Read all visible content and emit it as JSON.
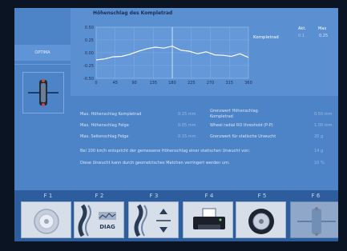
{
  "left_menu": {
    "items": [
      "",
      "",
      "OPTIMA"
    ]
  },
  "chart": {
    "title": "Höhenschlag des Kompletrad",
    "legend": {
      "akt_header": "Akt.",
      "max_header": "Max",
      "series_label": "Kompletrad",
      "akt_value": "0.1",
      "max_value": "0.25"
    }
  },
  "chart_data": {
    "type": "line",
    "title": "Höhenschlag des Kompletrad",
    "xlabel": "",
    "ylabel": "",
    "xlim": [
      0,
      360
    ],
    "ylim": [
      -0.5,
      0.5
    ],
    "x_ticks": [
      "0",
      "45",
      "90",
      "135",
      "180",
      "225",
      "270",
      "315",
      "360"
    ],
    "y_ticks": [
      "0.50",
      "0.25",
      "0.00",
      "-0.25",
      "-0.50"
    ],
    "grid": true,
    "cursor_x": 180,
    "series": [
      {
        "name": "Kompletrad",
        "color": "#ffffff",
        "x": [
          0,
          20,
          40,
          60,
          80,
          100,
          120,
          140,
          160,
          180,
          200,
          220,
          240,
          260,
          280,
          300,
          320,
          340,
          360
        ],
        "values": [
          -0.14,
          -0.12,
          -0.08,
          -0.07,
          -0.03,
          0.03,
          0.08,
          0.11,
          0.09,
          0.13,
          0.05,
          0.03,
          -0.02,
          0.02,
          -0.04,
          -0.05,
          -0.07,
          -0.02,
          -0.09
        ]
      }
    ]
  },
  "results": {
    "rows": [
      {
        "label": "Max. Höhenschlag Kompletrad",
        "value": "0.25 mm",
        "label2": "Grenzwert Höhenschlag Kompletrad",
        "value2": "0.50 mm"
      },
      {
        "label": "Max. Höhenschlag Felge",
        "value": "0.05 mm",
        "label2": "Wheel radial RO threshold (P-P)",
        "value2": "1.00 mm"
      },
      {
        "label": "Max. Seitenschlag Felge",
        "value": "0.15 mm",
        "label2": "Grenzwert für statische Unwucht",
        "value2": "20 g"
      }
    ],
    "line1": "Bei 100 km/h entspricht der gemessene Höhenschlag einer statischen Unwucht von:",
    "line1_value": "14 g",
    "line2": "Diese Unwucht kann durch geometrisches Matchen verringert werden um:",
    "line2_value": "10 %"
  },
  "fkeys": [
    {
      "label": "F 1",
      "icon": "wheel-icon"
    },
    {
      "label": "F 2",
      "icon": "tire-diag-icon",
      "text": "DIAG"
    },
    {
      "label": "F 3",
      "icon": "tire-adjust-icon"
    },
    {
      "label": "F 4",
      "icon": "printer-icon"
    },
    {
      "label": "F 5",
      "icon": "tire-wheel-icon"
    },
    {
      "label": "F 6",
      "icon": "balancer-icon"
    }
  ],
  "colors": {
    "background": "#4d83c7",
    "panel": "#5a8fd2",
    "series_line": "#ffffff",
    "text_dark": "#1b2f55"
  }
}
